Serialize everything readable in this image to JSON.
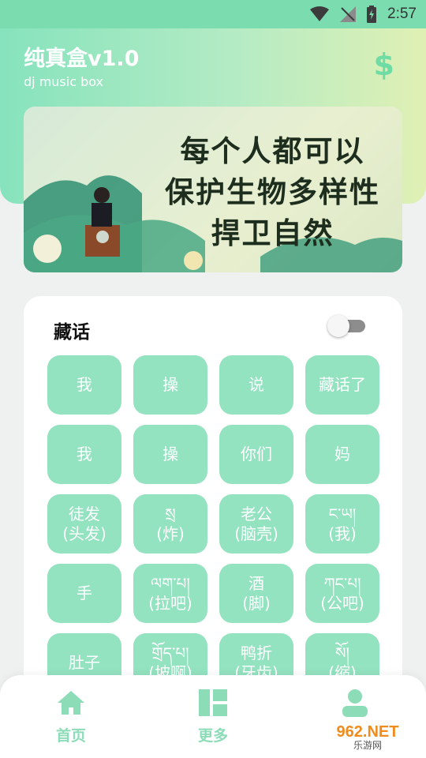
{
  "status_bar": {
    "time": "2:57"
  },
  "header": {
    "title": "纯真盒v1.0",
    "subtitle": "dj music box"
  },
  "banner": {
    "lines": [
      "每个人都可以",
      "保护生物多样性",
      "捍卫自然"
    ]
  },
  "card": {
    "title": "藏话",
    "toggle_on": false,
    "buttons": [
      "我",
      "操",
      "说",
      "藏话了",
      "我",
      "操",
      "你们",
      "妈",
      "徒发\n(头发)",
      "སྲ\n(炸)",
      "老公\n(脑壳)",
      "ང་ཡ།\n(我)",
      "手",
      "ལག་པ།\n(拉吧)",
      "酒\n(脚)",
      "ཀང་པ།\n(公吧)",
      "肚子",
      "གྲོད་པ།\n(坡啊)",
      "鸭折\n(牙齿)",
      "སོ།\n(缩)"
    ]
  },
  "bottom_nav": {
    "items": [
      {
        "label": "首页",
        "icon": "home-icon"
      },
      {
        "label": "更多",
        "icon": "grid-icon"
      },
      {
        "label": "",
        "icon": "user-icon"
      }
    ]
  },
  "watermark": {
    "brand": "962.NET",
    "sub": "乐游网"
  },
  "colors": {
    "accent": "#93e2c0",
    "header_start": "#86e3bd",
    "header_end": "#e0f0b4"
  }
}
